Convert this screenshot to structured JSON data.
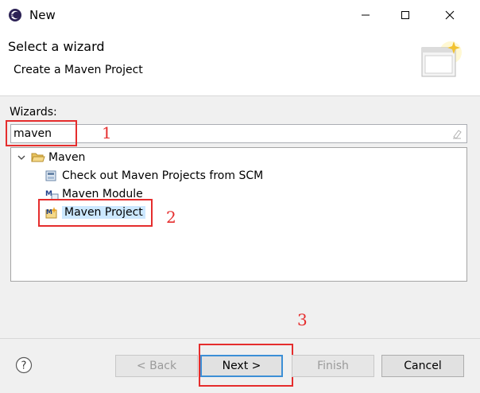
{
  "window": {
    "title": "New",
    "app_icon": "eclipse-icon",
    "minimize_icon": "minimize-icon",
    "maximize_icon": "maximize-icon",
    "close_icon": "close-icon"
  },
  "header": {
    "title": "Select a wizard",
    "subtitle": "Create a Maven Project",
    "banner_icon": "wizard-banner-icon"
  },
  "wizards": {
    "label": "Wizards:",
    "filter_value": "maven",
    "clear_icon": "clear-filter-icon"
  },
  "tree": {
    "category": {
      "label": "Maven",
      "expanded": true,
      "icon": "folder-open-icon"
    },
    "items": [
      {
        "label": "Check out Maven Projects from SCM",
        "icon": "maven-scm-icon",
        "selected": false
      },
      {
        "label": "Maven Module",
        "icon": "maven-module-icon",
        "selected": false
      },
      {
        "label": "Maven Project",
        "icon": "maven-project-icon",
        "selected": true
      }
    ]
  },
  "annotations": {
    "step1": "1",
    "step2": "2",
    "step3": "3",
    "color": "#e52d2d"
  },
  "buttons": {
    "help_icon": "help-icon",
    "back": "< Back",
    "next": "Next >",
    "finish": "Finish",
    "cancel": "Cancel"
  },
  "colors": {
    "selection": "#cce8ff",
    "focus_border": "#3c8fd6"
  }
}
